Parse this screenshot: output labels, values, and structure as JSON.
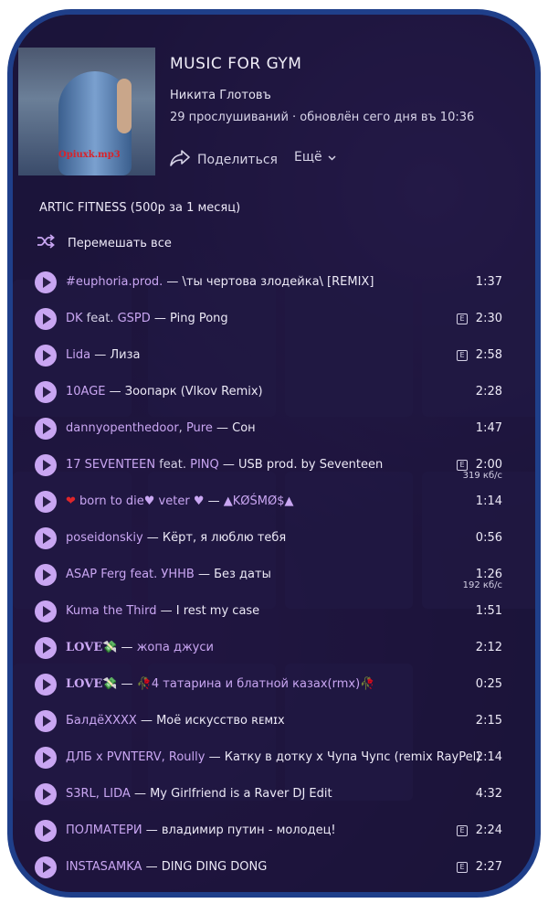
{
  "playlist": {
    "title": "MUSIC FOR GYM",
    "author": "Никита Глотовъ",
    "meta": "29 прослушиваний · обновлён сего дня въ 10:36",
    "cover_tag": "Opiuxk.mp3",
    "share_label": "Поделиться",
    "more_label": "Ещё"
  },
  "section_label": "ARTIC FITNESS (500р за 1 месяц)",
  "shuffle_label": "Перемешать все",
  "tracks": [
    {
      "artist": "#euphoria.prod.",
      "feat": "",
      "feat_artist": "",
      "sep": " — ",
      "title": "\\ты чертова злодейка\\ [REMIX]",
      "duration": "1:37",
      "explicit": false,
      "bitrate": ""
    },
    {
      "artist": "DK",
      "feat": " feat. ",
      "feat_artist": "GSPD",
      "sep": " — ",
      "title": "Ping Pong",
      "duration": "2:30",
      "explicit": true,
      "bitrate": ""
    },
    {
      "artist": "Lida",
      "feat": "",
      "feat_artist": "",
      "sep": " — ",
      "title": "Лиза",
      "duration": "2:58",
      "explicit": true,
      "bitrate": ""
    },
    {
      "artist": "10AGE",
      "feat": "",
      "feat_artist": "",
      "sep": " — ",
      "title": "Зоопарк (Vlkov Remix)",
      "duration": "2:28",
      "explicit": false,
      "bitrate": ""
    },
    {
      "artist": "dannyopenthedoor",
      "feat": ", ",
      "feat_artist": "Pure",
      "sep": " — ",
      "title": "Сон",
      "duration": "1:47",
      "explicit": false,
      "bitrate": ""
    },
    {
      "artist": "17 SEVENTEEN",
      "feat": " feat. ",
      "feat_artist": "PINQ",
      "sep": " — ",
      "title": "USB prod. by Seventeen",
      "duration": "2:00",
      "explicit": true,
      "bitrate": "319 кб/с"
    },
    {
      "artist": "born to die♥ veter ♥",
      "feat": "",
      "feat_artist": "",
      "sep": " — ",
      "title": "▲KØŚMØ$▲",
      "duration": "1:14",
      "explicit": false,
      "bitrate": "",
      "heart": "❤",
      "purple_title": true
    },
    {
      "artist": "poseidonskiy",
      "feat": "",
      "feat_artist": "",
      "sep": " — ",
      "title": "Кёрт, я люблю тебя",
      "duration": "0:56",
      "explicit": false,
      "bitrate": ""
    },
    {
      "artist": "ASAP Ferg feat. УННВ",
      "feat": "",
      "feat_artist": "",
      "sep": " — ",
      "title": "Без даты",
      "duration": "1:26",
      "explicit": false,
      "bitrate": "192 кб/с"
    },
    {
      "artist": "Kuma the Third",
      "feat": "",
      "feat_artist": "",
      "sep": " — ",
      "title": "I rest my case",
      "duration": "1:51",
      "explicit": false,
      "bitrate": ""
    },
    {
      "artist": "LOVE💸",
      "feat": "",
      "feat_artist": "",
      "sep": " — ",
      "title": "жопа джуси",
      "duration": "2:12",
      "explicit": false,
      "bitrate": "",
      "love": true,
      "purple_title": true
    },
    {
      "artist": "LOVE💸",
      "feat": "",
      "feat_artist": "",
      "sep": " — ",
      "title": "🥀4 татарина и блатной казах(rmx)🥀",
      "duration": "0:25",
      "explicit": false,
      "bitrate": "",
      "love": true,
      "purple_title": true
    },
    {
      "artist": "БалдёХХХХ",
      "feat": "",
      "feat_artist": "",
      "sep": " — ",
      "title": "Моё искусство ʀᴇᴍɪx",
      "duration": "2:15",
      "explicit": false,
      "bitrate": ""
    },
    {
      "artist": "ДЛБ x PVNTERV, Roully",
      "feat": "",
      "feat_artist": "",
      "sep": " — ",
      "title": "Катку в дотку x Чупа Чупс (remix RayPel)",
      "duration": "2:14",
      "explicit": false,
      "bitrate": ""
    },
    {
      "artist": "S3RL, LIDA",
      "feat": "",
      "feat_artist": "",
      "sep": " — ",
      "title": "My Girlfriend is a Raver DJ Edit",
      "duration": "4:32",
      "explicit": false,
      "bitrate": ""
    },
    {
      "artist": "ПОЛМАТЕРИ",
      "feat": "",
      "feat_artist": "",
      "sep": " — ",
      "title": "владимир путин - молодец!",
      "duration": "2:24",
      "explicit": true,
      "bitrate": ""
    },
    {
      "artist": "INSTASAMKA",
      "feat": "",
      "feat_artist": "",
      "sep": " — ",
      "title": "DING DING DONG",
      "duration": "2:27",
      "explicit": true,
      "bitrate": ""
    }
  ],
  "colors": {
    "accent": "#c9a6f2",
    "frame": "#1f3f8a",
    "background": "#1c1538"
  }
}
